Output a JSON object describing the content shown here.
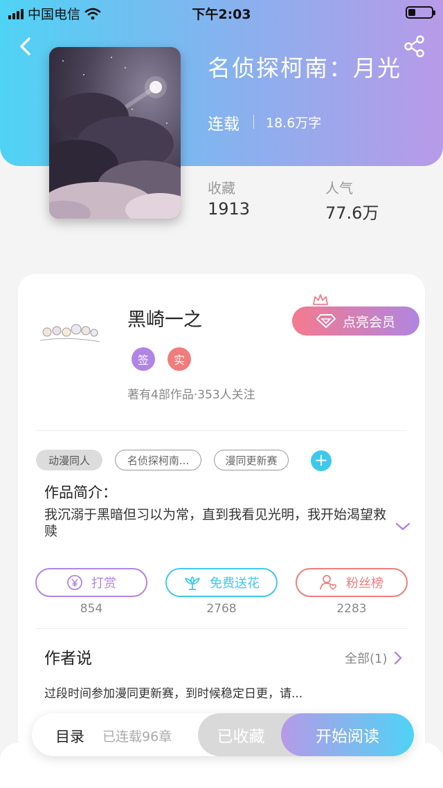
{
  "status_bar": {
    "carrier": "中国电信",
    "time": "下午2:03"
  },
  "book": {
    "title": "名侦探柯南：月光",
    "status": "连载",
    "word_count": "18.6万字",
    "stats": [
      {
        "label": "收藏",
        "value": "1913"
      },
      {
        "label": "人气",
        "value": "77.6万"
      }
    ]
  },
  "author": {
    "name": "黑崎一之",
    "vip_label": "点亮会员",
    "badges": [
      {
        "text": "签",
        "color": "#b184e6"
      },
      {
        "text": "实",
        "color": "#f07c7c"
      }
    ],
    "meta": "著有4部作品·353人关注"
  },
  "tags": [
    "动漫同人",
    "名侦探柯南...",
    "漫同更新赛"
  ],
  "intro": {
    "heading": "作品简介：",
    "text": "我沉溺于黑暗但习以为常，直到我看见光明，我开始渴望救赎"
  },
  "actions": [
    {
      "label": "打赏",
      "count": "854",
      "color": "#b184e6"
    },
    {
      "label": "免费送花",
      "count": "2768",
      "color": "#3fc8ee"
    },
    {
      "label": "粉丝榜",
      "count": "2283",
      "color": "#f07c7c"
    }
  ],
  "author_says": {
    "title": "作者说",
    "all_label": "全部(1)",
    "note": "过段时间参加漫同更新赛，到时候稳定日更，请..."
  },
  "bottom_bar": {
    "toc": "目录",
    "chapters": "已连载96章",
    "collected": "已收藏",
    "read": "开始阅读"
  }
}
